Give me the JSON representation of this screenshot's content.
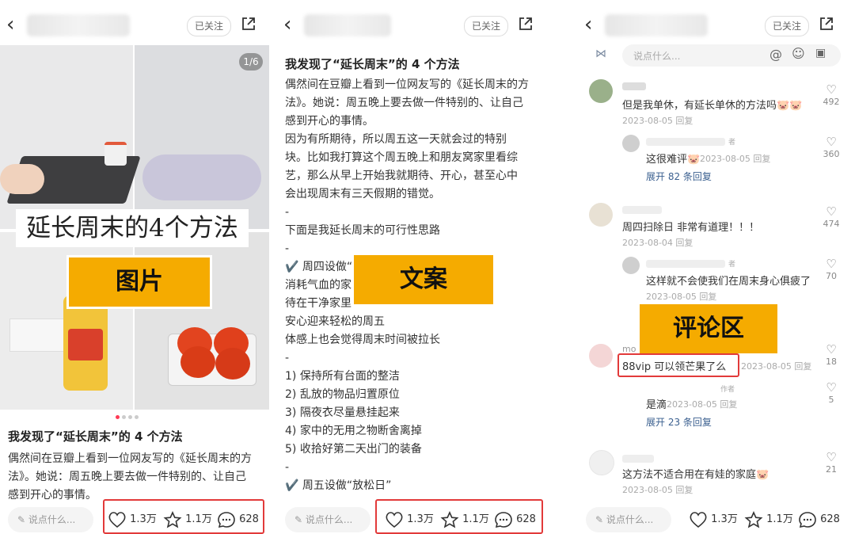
{
  "common": {
    "follow_label": "已关注",
    "say_placeholder": "说点什么...",
    "likes": "1.3万",
    "stars": "1.1万",
    "comments": "628"
  },
  "panel1": {
    "page_indicator": "1/6",
    "overlay_title": "延长周末的4个方法",
    "section_label": "图片",
    "post_title": "我发现了“延长周末”的 4 个方法",
    "post_lines": [
      "偶然间在豆瓣上看到一位网友写的《延长周末的方",
      "法》。她说：周五晚上要去做一件特别的、让自己",
      "感到开心的事情。"
    ]
  },
  "panel2": {
    "section_label": "文案",
    "title": "我发现了“延长周末”的 4 个方法",
    "lines": [
      "偶然间在豆瓣上看到一位网友写的《延长周末的方",
      "法》。她说：周五晚上要去做一件特别的、让自己",
      "感到开心的事情。",
      "因为有所期待，所以周五这一天就会过的特别",
      "块。比如我打算这个周五晚上和朋友窝家里看综",
      "艺，那么从早上开始我就期待、开心，甚至心中",
      "会出现周末有三天假期的错觉。",
      "-",
      "下面是我延长周末的可行性思路",
      "-",
      "✔️ 周四设做“",
      "消耗气血的家",
      "待在干净家里",
      "安心迎来轻松的周五",
      "体感上也会觉得周末时间被拉长",
      "-",
      "1) 保持所有台面的整洁",
      "2) 乱放的物品归置原位",
      "3) 隔夜衣尽量悬挂起来",
      "4) 家中的无用之物断舍离掉",
      "5) 收拾好第二天出门的装备",
      "-",
      "✔️ 周五设做“放松日”"
    ]
  },
  "panel3": {
    "section_label": "评论区",
    "input_placeholder": "说点什么...",
    "comments": [
      {
        "text": "但是我单休，有延长单休的方法吗🐷🐷",
        "meta": "2023-08-05 回复",
        "likes": "492"
      },
      {
        "text": "这很难评🐷",
        "meta": "2023-08-05 回复",
        "likes": "360",
        "badge": "者"
      },
      {
        "text": "周四扫除日 非常有道理！！！",
        "meta": "2023-08-04 回复",
        "likes": "474"
      },
      {
        "text": "这样就不会使我们在周末身心俱疲了",
        "meta": "2023-08-05 回复",
        "likes": "70",
        "badge": "者"
      },
      {
        "name": "mo",
        "text": "88vip 可以领芒果了么",
        "meta": "2023-08-05 回复",
        "likes": "18"
      },
      {
        "text": "是滴",
        "meta": "2023-08-05 回复",
        "likes": "5",
        "badge": "作者"
      },
      {
        "text": "这方法不适合用在有娃的家庭🐷",
        "meta": "2023-08-05 回复",
        "likes": "21"
      }
    ],
    "expand1": "展开 82 条回复",
    "expand2": "展开 23 条回复"
  },
  "colors": {
    "accent_label": "#f5ab00",
    "highlight_border": "#e23a3a",
    "link": "#3a5f8f"
  }
}
